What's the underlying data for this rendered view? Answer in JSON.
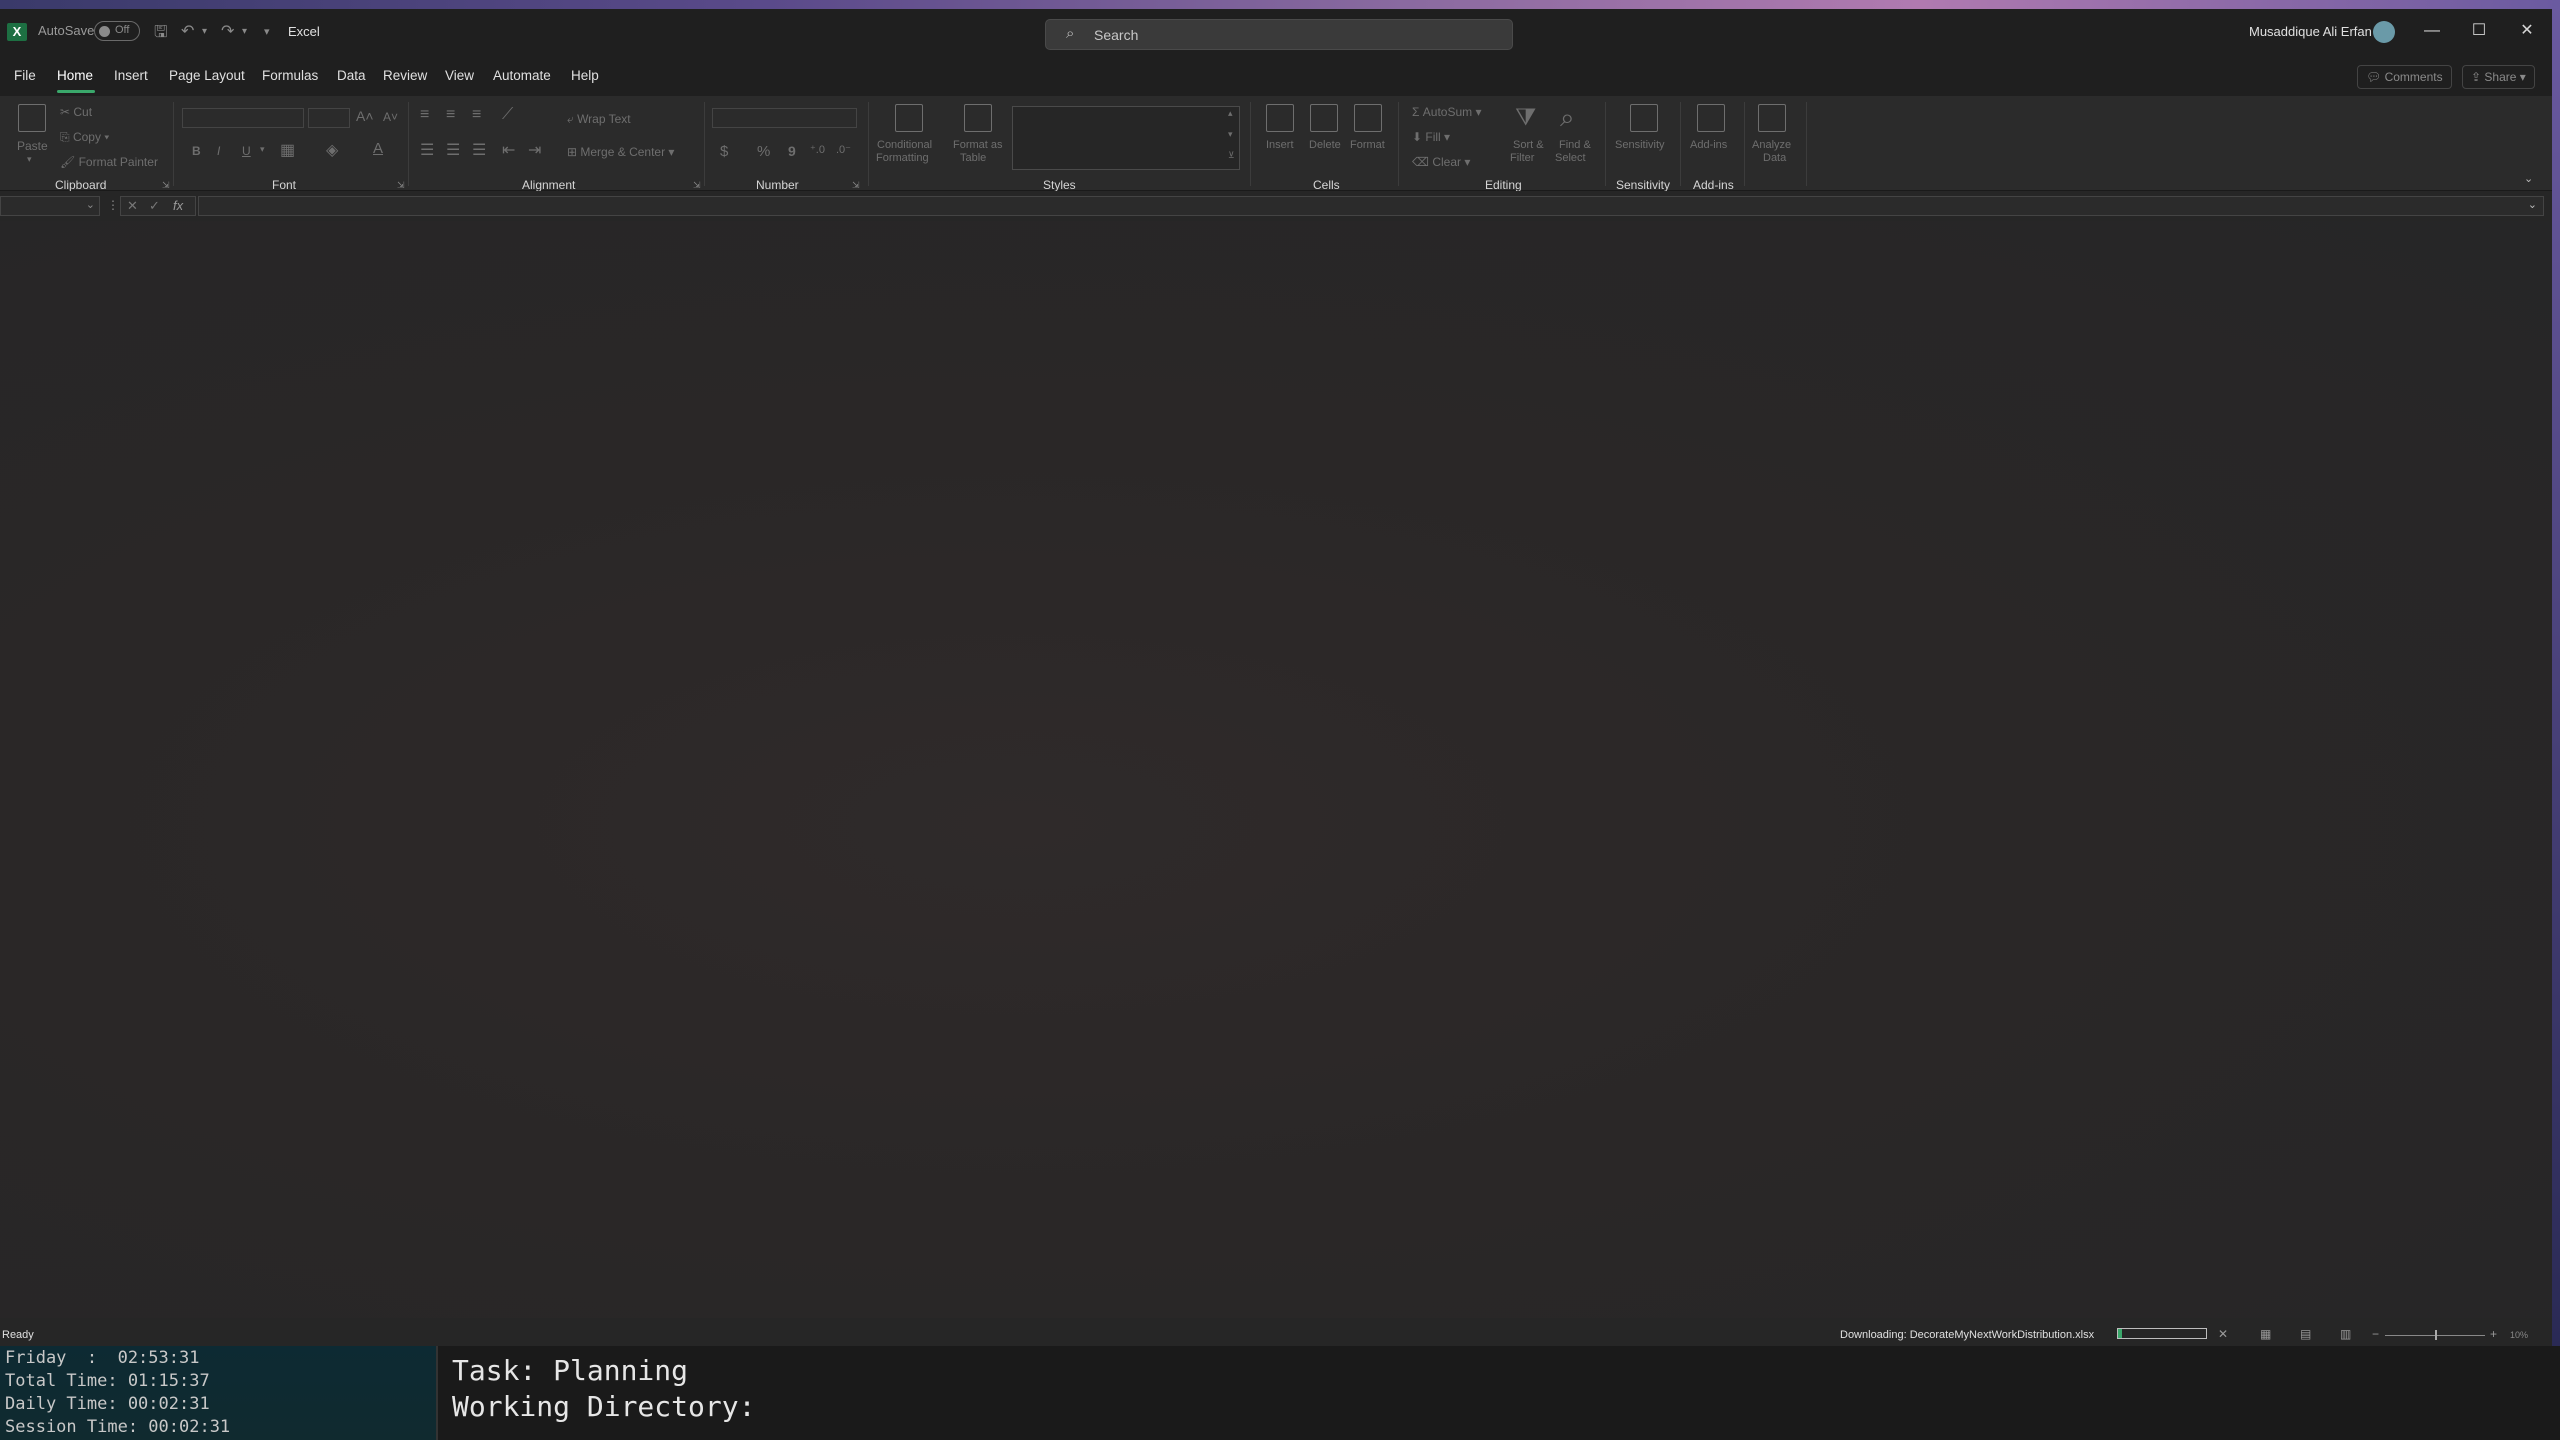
{
  "titlebar": {
    "autosave_label": "AutoSave",
    "autosave_state": "Off",
    "app_name": "Excel",
    "search_placeholder": "Search",
    "user_name": "Musaddique Ali Erfan"
  },
  "tabs": [
    "File",
    "Home",
    "Insert",
    "Page Layout",
    "Formulas",
    "Data",
    "Review",
    "View",
    "Automate",
    "Help"
  ],
  "active_tab": "Home",
  "top_buttons": {
    "comments": "Comments",
    "share": "Share"
  },
  "ribbon": {
    "clipboard": {
      "label": "Clipboard",
      "paste": "Paste",
      "cut": "Cut",
      "copy": "Copy",
      "format_painter": "Format Painter"
    },
    "font": {
      "label": "Font",
      "bold": "B",
      "italic": "I",
      "underline": "U"
    },
    "alignment": {
      "label": "Alignment",
      "wrap_text": "Wrap Text",
      "merge_center": "Merge & Center"
    },
    "number": {
      "label": "Number",
      "currency": "$",
      "percent": "%",
      "comma": "9"
    },
    "styles": {
      "label": "Styles",
      "conditional_1": "Conditional",
      "conditional_2": "Formatting",
      "format_table_1": "Format as",
      "format_table_2": "Table"
    },
    "cells": {
      "label": "Cells",
      "insert": "Insert",
      "delete": "Delete",
      "format": "Format"
    },
    "editing": {
      "label": "Editing",
      "autosum": "AutoSum",
      "fill": "Fill",
      "clear": "Clear",
      "sort_1": "Sort &",
      "sort_2": "Filter",
      "find_1": "Find &",
      "find_2": "Select"
    },
    "sensitivity": {
      "label": "Sensitivity",
      "button": "Sensitivity"
    },
    "addins": {
      "label": "Add-ins",
      "button": "Add-ins"
    },
    "analyze": {
      "line1": "Analyze",
      "line2": "Data"
    }
  },
  "statusbar": {
    "ready": "Ready",
    "download": "Downloading: DecorateMyNextWorkDistribution.xlsx",
    "download_progress": 0.05,
    "zoom": "10%"
  },
  "terminal_left": {
    "line1": "Friday  :  02:53:31",
    "line2": "Total Time: 01:15:37",
    "line3": "Daily Time: 00:02:31",
    "line4": "Session Time: 00:02:31"
  },
  "terminal_right": {
    "task": "Task: Planning",
    "working_dir": "Working Directory:"
  }
}
